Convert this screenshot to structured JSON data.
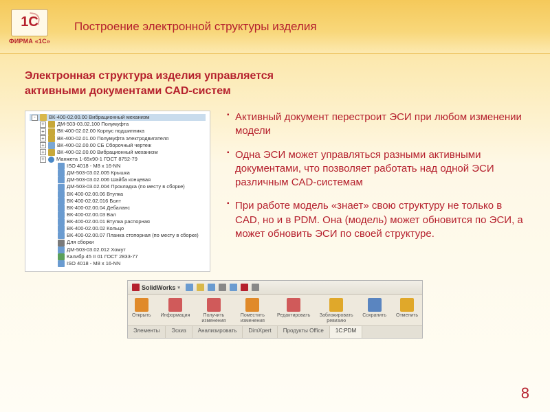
{
  "logo": {
    "symbol": "1C",
    "firm": "ФИРМА «1С»"
  },
  "title": "Построение электронной структуры изделия",
  "subtitle": "Электронная структура изделия управляется\nактивными документами CAD-систем",
  "bullets": [
    "Активный документ перестроит ЭСИ при любом изменении модели",
    "Одна ЭСИ может управляться разными активными документами, что позволяет работать над одной ЭСИ различным CAD-системам",
    "При работе модель «знает» свою структуру не только в CAD, но и в PDM. Она (модель) может обновится по ЭСИ, а может обновить ЭСИ по своей структуре."
  ],
  "tree": [
    {
      "d": 0,
      "pm": "-",
      "ic": "ic-folder",
      "t": "ВК-400-02.00.00 Вибрационный механизм",
      "sel": true
    },
    {
      "d": 1,
      "pm": "+",
      "ic": "ic-folder-y",
      "t": "ДМ-503-03.02.100 Полумуфта"
    },
    {
      "d": 1,
      "pm": "+",
      "ic": "ic-folder-y",
      "t": "ВК-400-02.02.00 Корпус подшипника"
    },
    {
      "d": 1,
      "pm": "+",
      "ic": "ic-folder-y",
      "t": "ВК-400-02.01.00 Полумуфта электродвигателя"
    },
    {
      "d": 1,
      "pm": "+",
      "ic": "ic-itm",
      "t": "ВК-400-02.00.00 СБ Сборочный чертеж"
    },
    {
      "d": 1,
      "pm": "+",
      "ic": "ic-folder-y",
      "t": "ВК-400-02.00.00 Вибрационный механизм"
    },
    {
      "d": 1,
      "pm": "+",
      "ic": "ic-unit",
      "t": "Манжета 1-65х90-1 ГОСТ 8752-79"
    },
    {
      "d": 2,
      "pm": " ",
      "ic": "ic-part",
      "t": "ISO 4018 - M8 x 16-NN"
    },
    {
      "d": 2,
      "pm": " ",
      "ic": "ic-part",
      "t": "ДМ-503-03.02.005 Крышка"
    },
    {
      "d": 2,
      "pm": " ",
      "ic": "ic-part",
      "t": "ДМ-503-03.02.006 Шайба концевая"
    },
    {
      "d": 2,
      "pm": " ",
      "ic": "ic-part",
      "t": "ДМ-503-03.02.004 Прокладка (по месту в сборке)"
    },
    {
      "d": 2,
      "pm": " ",
      "ic": "ic-part",
      "t": "ВК-400-02.00.06 Втулка"
    },
    {
      "d": 2,
      "pm": " ",
      "ic": "ic-part",
      "t": "ВК-400-02.02.016 Болт"
    },
    {
      "d": 2,
      "pm": " ",
      "ic": "ic-part",
      "t": "ВК-400-02.00.04 Дебаланс"
    },
    {
      "d": 2,
      "pm": " ",
      "ic": "ic-part",
      "t": "ВК-400-02.00.03 Вал"
    },
    {
      "d": 2,
      "pm": " ",
      "ic": "ic-part",
      "t": "ВК-400-02.00.01 Втулка распорная"
    },
    {
      "d": 2,
      "pm": " ",
      "ic": "ic-part",
      "t": "ВК-400-02.00.02 Кольцо"
    },
    {
      "d": 2,
      "pm": " ",
      "ic": "ic-part",
      "t": "ВК-400-02.00.07 Планка стопорная (по месту в сборке)"
    },
    {
      "d": 2,
      "pm": " ",
      "ic": "ic-gear",
      "t": "Для сборки"
    },
    {
      "d": 2,
      "pm": " ",
      "ic": "ic-part",
      "t": "ДМ-503-03.02.012 Хомут"
    },
    {
      "d": 2,
      "pm": " ",
      "ic": "ic-link",
      "t": "Калибр 45 II 01 ГОСТ 2833-77"
    },
    {
      "d": 2,
      "pm": " ",
      "ic": "ic-part",
      "t": "ISO 4018 - M8 x 16-NN"
    }
  ],
  "sw": {
    "title": "SolidWorks",
    "ribbon": [
      {
        "label": "Открыть",
        "color": "#e08a2a"
      },
      {
        "label": "Информация",
        "color": "#d05a5a"
      },
      {
        "label": "Получить изменения",
        "color": "#d05a5a"
      },
      {
        "label": "Поместить изменения",
        "color": "#e08a2a"
      },
      {
        "label": "Редактировать",
        "color": "#d05a5a"
      },
      {
        "label": "Заблокировать ревизию",
        "color": "#e0a82a"
      },
      {
        "label": "Сохранить",
        "color": "#5a85c0"
      },
      {
        "label": "Отменить",
        "color": "#e0a82a"
      }
    ],
    "tabs": [
      "Элементы",
      "Эскиз",
      "Анализировать",
      "DimXpert",
      "Продукты Office",
      "1C:PDM"
    ],
    "active_tab": "1C:PDM"
  },
  "page": "8"
}
